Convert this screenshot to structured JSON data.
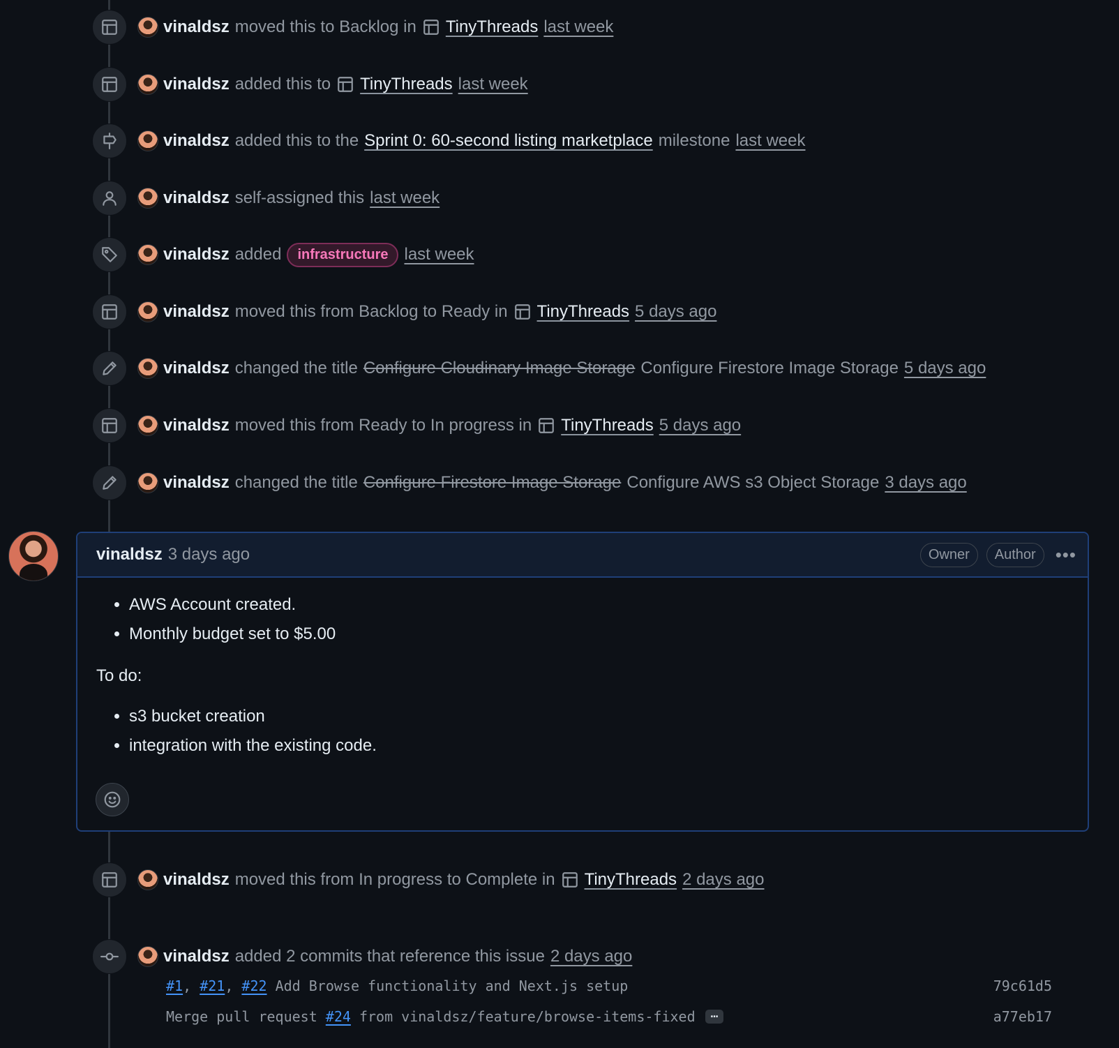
{
  "timeline": {
    "events": [
      {
        "user": "vinaldsz",
        "action": "moved this to Backlog in",
        "project": "TinyThreads",
        "time": "last week"
      },
      {
        "user": "vinaldsz",
        "action": "added this to",
        "project": "TinyThreads",
        "time": "last week"
      },
      {
        "user": "vinaldsz",
        "action": "added this to the",
        "milestone": "Sprint 0: 60-second listing marketplace",
        "suffix": "milestone",
        "time": "last week"
      },
      {
        "user": "vinaldsz",
        "action": "self-assigned this",
        "time": "last week"
      },
      {
        "user": "vinaldsz",
        "action": "added",
        "label": "infrastructure",
        "label_color": "#f778ba",
        "time": "last week"
      },
      {
        "user": "vinaldsz",
        "action": "moved this from Backlog to Ready in",
        "project": "TinyThreads",
        "time": "5 days ago"
      },
      {
        "user": "vinaldsz",
        "action": "changed the title",
        "old_title": "Configure Cloudinary Image Storage",
        "new_title": "Configure Firestore Image Storage",
        "time": "5 days ago"
      },
      {
        "user": "vinaldsz",
        "action": "moved this from Ready to In progress in",
        "project": "TinyThreads",
        "time": "5 days ago"
      },
      {
        "user": "vinaldsz",
        "action": "changed the title",
        "old_title": "Configure Firestore Image Storage",
        "new_title": "Configure AWS s3 Object Storage",
        "time": "3 days ago"
      },
      {
        "user": "vinaldsz",
        "action": "moved this from In progress to Complete in",
        "project": "TinyThreads",
        "time": "2 days ago"
      },
      {
        "user": "vinaldsz",
        "action": "added 2 commits that reference this issue",
        "time": "2 days ago"
      }
    ],
    "icons": [
      "table-icon",
      "milestone-icon",
      "person-icon",
      "tag-icon",
      "pencil-icon",
      "git-commit-icon",
      "smiley-icon",
      "kebab-horizontal-icon"
    ]
  },
  "comment": {
    "author": "vinaldsz",
    "time": "3 days ago",
    "badges": [
      "Owner",
      "Author"
    ],
    "list1": [
      "AWS Account created.",
      "Monthly budget set to $5.00"
    ],
    "paragraph": "To do:",
    "list2": [
      "s3 bucket creation",
      "integration with the existing code."
    ]
  },
  "commits": [
    {
      "refs": [
        "#1",
        "#21",
        "#22"
      ],
      "separator": ",",
      "message": "Add Browse functionality and Next.js setup",
      "sha": "79c61d5"
    },
    {
      "prefix": "Merge pull request",
      "ref": "#24",
      "message": "from vinaldsz/feature/browse-items-fixed",
      "expand": "…",
      "sha": "a77eb17"
    }
  ],
  "colors": {
    "background": "#0d1117",
    "accent_border": "#1f3f78",
    "link": "#4493f8",
    "label": "#f778ba"
  }
}
